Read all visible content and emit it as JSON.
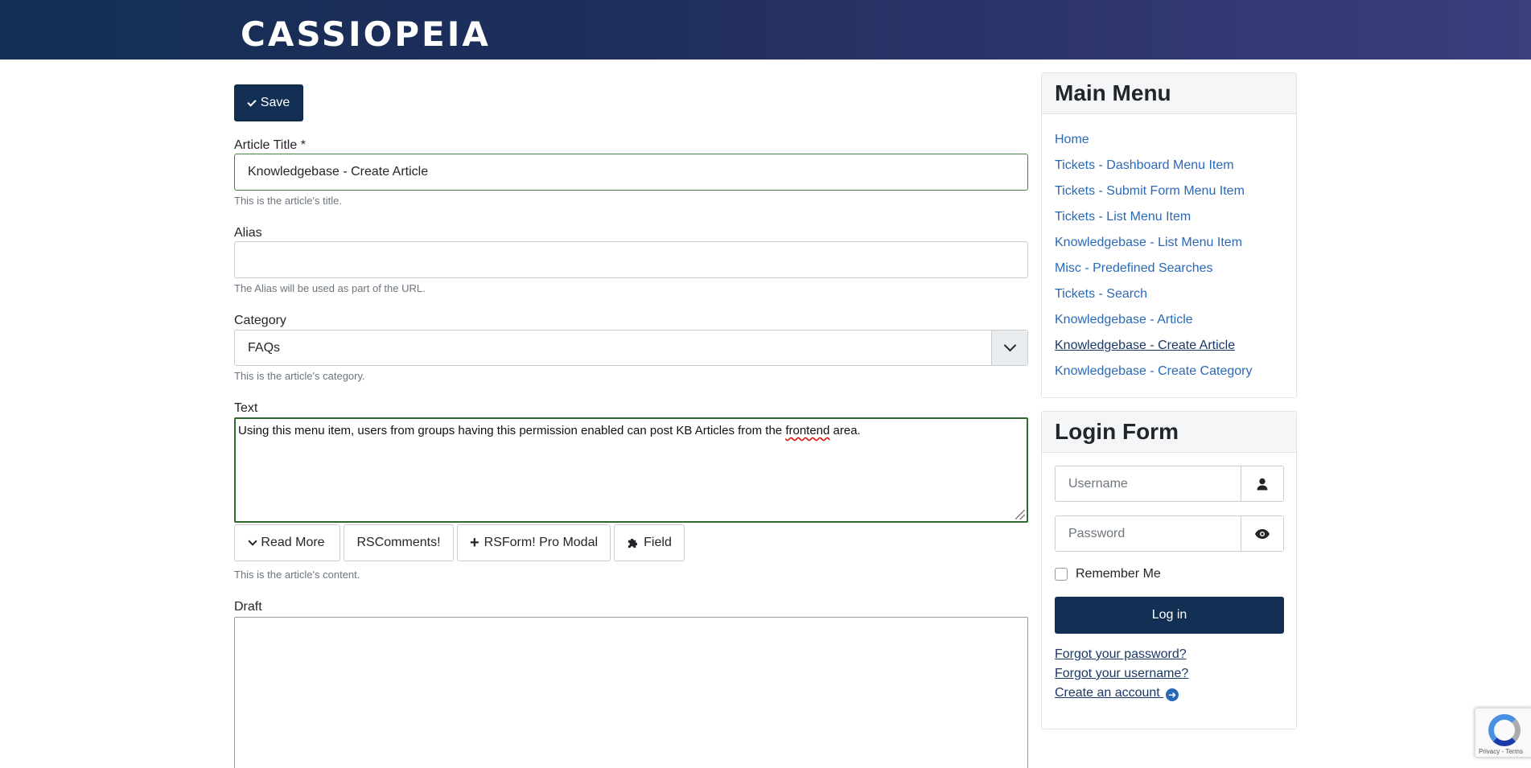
{
  "header": {
    "brand": "CASSIOPEIA"
  },
  "form": {
    "save_label": "Save",
    "title_label": "Article Title *",
    "title_value": "Knowledgebase - Create Article",
    "title_hint": "This is the article's title.",
    "alias_label": "Alias",
    "alias_value": "",
    "alias_hint": "The Alias will be used as part of the URL.",
    "category_label": "Category",
    "category_value": "FAQs",
    "category_hint": "This is the article's category.",
    "text_label": "Text",
    "text_before": "Using this menu item, users from groups having this permission enabled can post KB Articles from the ",
    "text_misspelled": "frontend",
    "text_after": " area.",
    "editor_buttons": {
      "read_more": "Read More",
      "rscomments": "RSComments!",
      "rsform": "RSForm! Pro Modal",
      "field": "Field"
    },
    "text_hint": "This is the article's content.",
    "draft_label": "Draft"
  },
  "main_menu": {
    "title": "Main Menu",
    "items": [
      "Home",
      "Tickets - Dashboard Menu Item",
      "Tickets - Submit Form Menu Item",
      "Tickets - List Menu Item",
      "Knowledgebase - List Menu Item",
      "Misc - Predefined Searches",
      "Tickets - Search",
      "Knowledgebase - Article",
      "Knowledgebase - Create Article",
      "Knowledgebase - Create Category"
    ],
    "active_item": "Knowledgebase - Create Article"
  },
  "login": {
    "title": "Login Form",
    "username_placeholder": "Username",
    "password_placeholder": "Password",
    "remember_label": "Remember Me",
    "login_button": "Log in",
    "forgot_password": "Forgot your password?",
    "forgot_username": "Forgot your username?",
    "create_account": "Create an account"
  },
  "recaptcha": {
    "footer": "Privacy - Terms"
  },
  "colors": {
    "primary": "#132f53",
    "link": "#2a69b8",
    "valid_border": "#448344"
  },
  "icons": [
    "check-icon",
    "chevron-down-icon",
    "plus-icon",
    "puzzle-icon",
    "user-icon",
    "eye-icon",
    "arrow-right-circle-icon",
    "recaptcha-icon"
  ]
}
